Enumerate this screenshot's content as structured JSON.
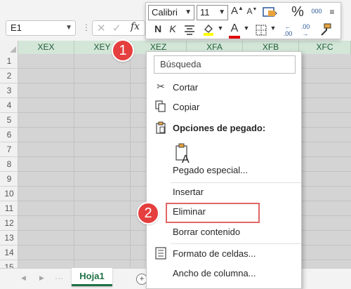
{
  "formula_bar": {
    "name_box": "E1",
    "fx": "fx"
  },
  "columns": [
    "XEX",
    "XEY",
    "XEZ",
    "XFA",
    "XFB",
    "XFC"
  ],
  "rows": [
    "1",
    "2",
    "3",
    "4",
    "5",
    "6",
    "7",
    "8",
    "9",
    "10",
    "11",
    "12",
    "13",
    "14",
    "15"
  ],
  "sheet_tab": "Hoja1",
  "mini_toolbar": {
    "font": "Calibri",
    "size": "11",
    "percent": "%",
    "thousands": "000",
    "bold": "N",
    "italic": "K",
    "colors": {
      "fill": "#ffff00",
      "font": "#e00000"
    }
  },
  "context_menu": {
    "search_placeholder": "Búsqueda",
    "items": {
      "cut": "Cortar",
      "copy": "Copiar",
      "paste_options": "Opciones de pegado:",
      "paste_special": "Pegado especial...",
      "insert": "Insertar",
      "delete": "Eliminar",
      "clear": "Borrar contenido",
      "format": "Formato de celdas...",
      "width": "Ancho de columna..."
    }
  },
  "callouts": {
    "one": "1",
    "two": "2"
  },
  "colors": {
    "accent": "#1e7145",
    "callout": "#e53e3e",
    "highlight": "#e06666",
    "selection": "#d4d4d4"
  }
}
